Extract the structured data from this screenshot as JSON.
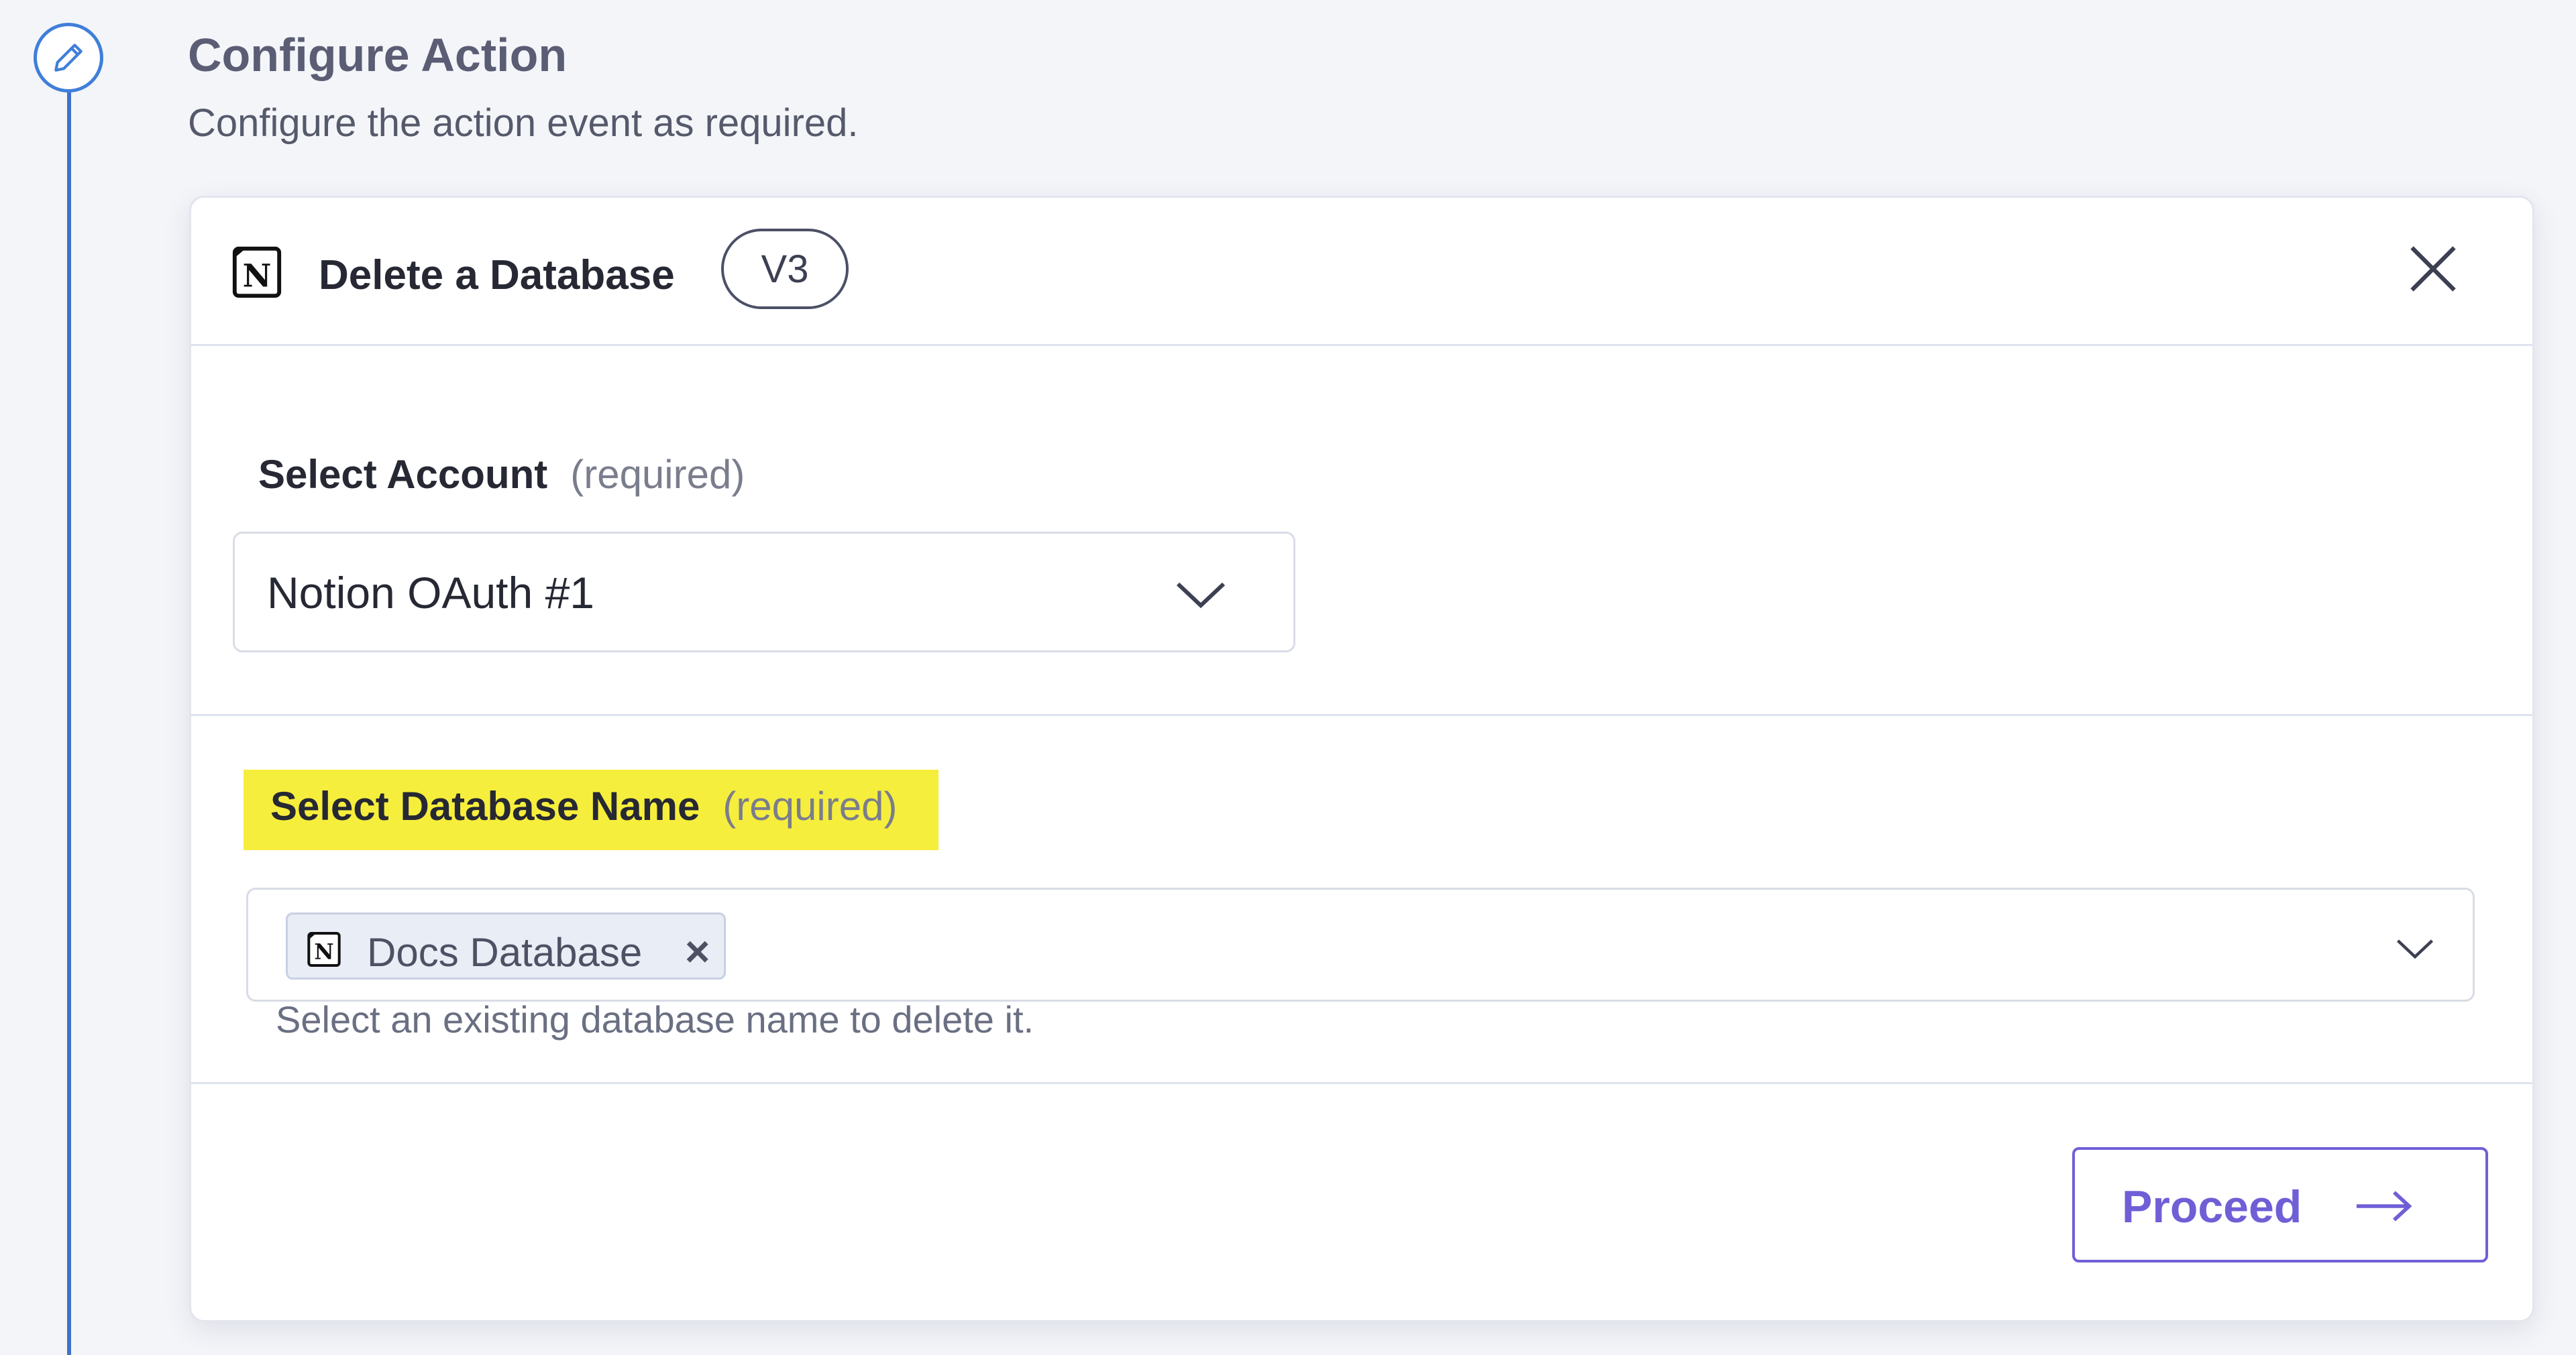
{
  "header": {
    "title": "Configure Action",
    "subtitle": "Configure the action event as required."
  },
  "card": {
    "title": "Delete a Database",
    "version": "V3"
  },
  "account_field": {
    "label": "Select Account",
    "required": "(required)",
    "value": "Notion OAuth #1"
  },
  "database_field": {
    "label": "Select Database Name",
    "required": "(required)",
    "chip_label": "Docs Database",
    "chip_remove": "×",
    "helper": "Select an existing database name to delete it."
  },
  "actions": {
    "proceed_label": "Proceed"
  },
  "icons": {
    "step": "pencil-icon",
    "app": "notion-icon",
    "close": "close-icon",
    "dropdown": "chevron-down-icon",
    "proceed": "arrow-right-icon"
  },
  "colors": {
    "accent": "#6f5fd6",
    "timeline": "#3f73c9",
    "highlight": "#f6ee3c"
  }
}
